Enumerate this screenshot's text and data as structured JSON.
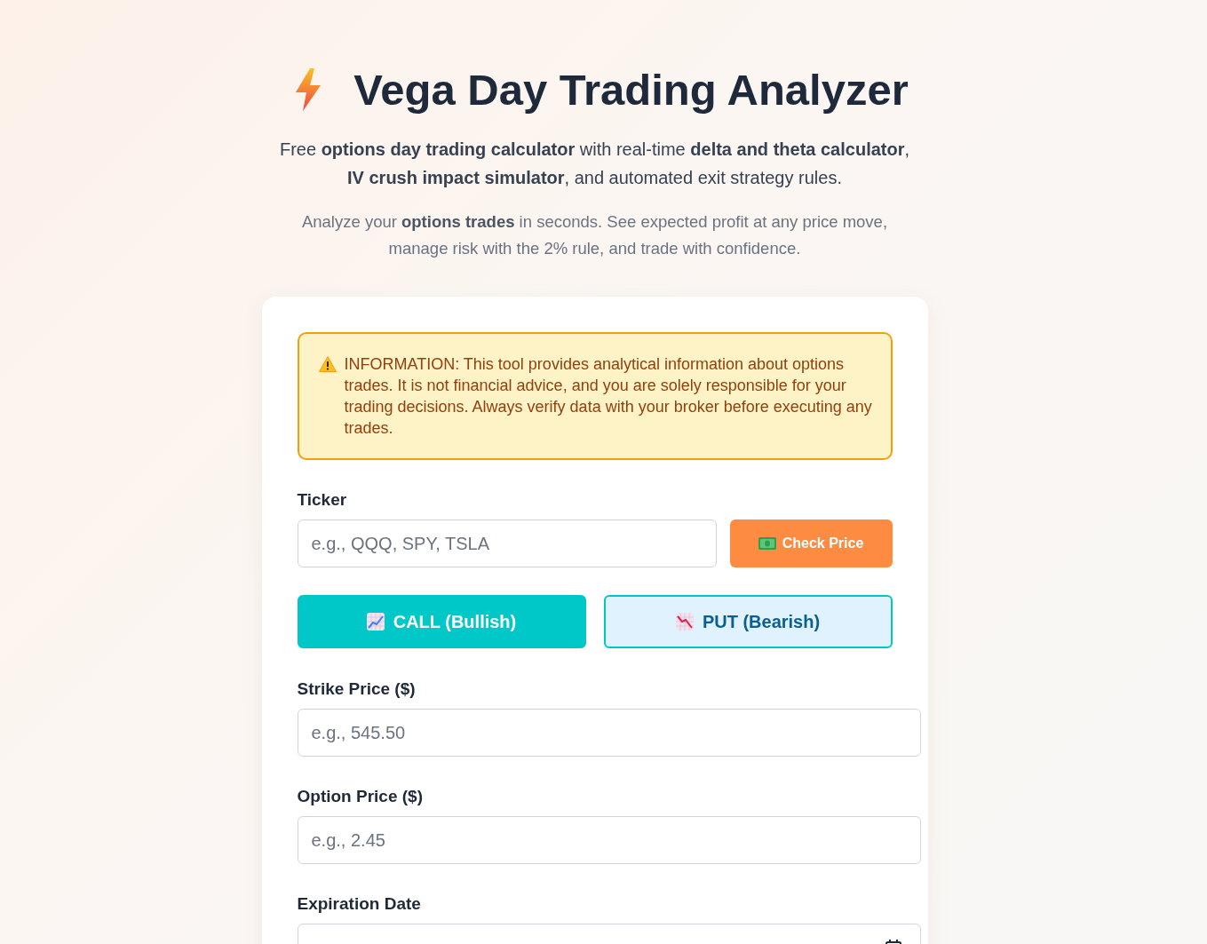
{
  "header": {
    "title": "Vega Day Trading Analyzer",
    "intro": "Free **options day trading calculator** with real-time **delta and theta calculator**, **IV crush impact simulator**, and automated exit strategy rules.",
    "tagline": "Analyze your **options trades** in seconds. See expected profit at any price move, manage risk with the 2% rule, and trade with confidence."
  },
  "notice": {
    "text": "INFORMATION: This tool provides analytical information about options trades. It is not financial advice, and you are solely responsible for your trading decisions. Always verify data with your broker before executing any trades."
  },
  "form": {
    "ticker": {
      "label": "Ticker",
      "placeholder": "e.g., QQQ, SPY, TSLA"
    },
    "check_price_button": "Check Price",
    "option_types": [
      {
        "kind": "call",
        "label": "CALL (Bullish)",
        "selected": true
      },
      {
        "kind": "put",
        "label": "PUT (Bearish)",
        "selected": false
      }
    ],
    "fields": [
      {
        "kind": "text",
        "label": "Strike Price ($)",
        "placeholder": "e.g., 545.50"
      },
      {
        "kind": "text",
        "label": "Option Price ($)",
        "placeholder": "e.g., 2.45"
      },
      {
        "kind": "date",
        "label": "Expiration Date"
      }
    ]
  }
}
